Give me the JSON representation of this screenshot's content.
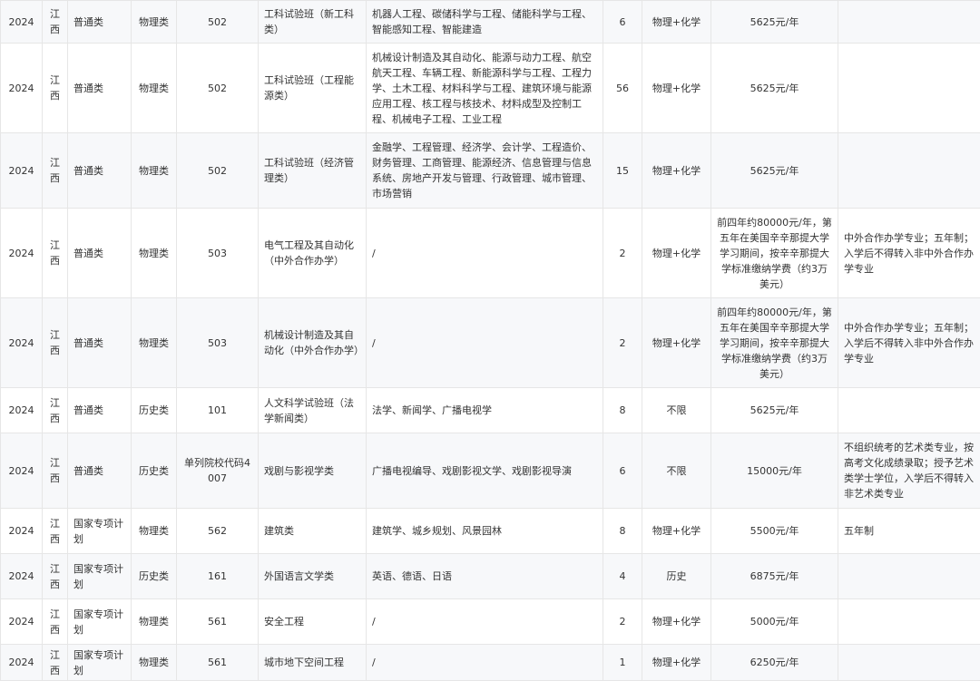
{
  "rows": [
    {
      "year": "2024",
      "province": "江西",
      "type": "普通类",
      "subject": "物理类",
      "code": "502",
      "group": "工科试验班（新工科类）",
      "majors": "机器人工程、碳储科学与工程、储能科学与工程、智能感知工程、智能建造",
      "count": "6",
      "requirement": "物理+化学",
      "tuition": "5625元/年",
      "note": ""
    },
    {
      "year": "2024",
      "province": "江西",
      "type": "普通类",
      "subject": "物理类",
      "code": "502",
      "group": "工科试验班（工程能源类）",
      "majors": "机械设计制造及其自动化、能源与动力工程、航空航天工程、车辆工程、新能源科学与工程、工程力学、土木工程、材料科学与工程、建筑环境与能源应用工程、核工程与核技术、材料成型及控制工程、机械电子工程、工业工程",
      "count": "56",
      "requirement": "物理+化学",
      "tuition": "5625元/年",
      "note": ""
    },
    {
      "year": "2024",
      "province": "江西",
      "type": "普通类",
      "subject": "物理类",
      "code": "502",
      "group": "工科试验班（经济管理类）",
      "majors": "金融学、工程管理、经济学、会计学、工程造价、财务管理、工商管理、能源经济、信息管理与信息系统、房地产开发与管理、行政管理、城市管理、市场营销",
      "count": "15",
      "requirement": "物理+化学",
      "tuition": "5625元/年",
      "note": ""
    },
    {
      "year": "2024",
      "province": "江西",
      "type": "普通类",
      "subject": "物理类",
      "code": "503",
      "group": "电气工程及其自动化（中外合作办学）",
      "majors": "/",
      "count": "2",
      "requirement": "物理+化学",
      "tuition": "前四年约80000元/年，第五年在美国辛辛那提大学学习期间，按辛辛那提大学标准缴纳学费（约3万美元）",
      "note": "中外合作办学专业；五年制；入学后不得转入非中外合作办学专业"
    },
    {
      "year": "2024",
      "province": "江西",
      "type": "普通类",
      "subject": "物理类",
      "code": "503",
      "group": "机械设计制造及其自动化（中外合作办学）",
      "majors": "/",
      "count": "2",
      "requirement": "物理+化学",
      "tuition": "前四年约80000元/年，第五年在美国辛辛那提大学学习期间，按辛辛那提大学标准缴纳学费（约3万美元）",
      "note": "中外合作办学专业；五年制；入学后不得转入非中外合作办学专业"
    },
    {
      "year": "2024",
      "province": "江西",
      "type": "普通类",
      "subject": "历史类",
      "code": "101",
      "group": "人文科学试验班（法学新闻类）",
      "majors": "法学、新闻学、广播电视学",
      "count": "8",
      "requirement": "不限",
      "tuition": "5625元/年",
      "note": ""
    },
    {
      "year": "2024",
      "province": "江西",
      "type": "普通类",
      "subject": "历史类",
      "code": "单列院校代码4007",
      "group": "戏剧与影视学类",
      "majors": "广播电视编导、戏剧影视文学、戏剧影视导演",
      "count": "6",
      "requirement": "不限",
      "tuition": "15000元/年",
      "note": "不组织统考的艺术类专业，按高考文化成绩录取；授予艺术类学士学位，入学后不得转入非艺术类专业"
    },
    {
      "year": "2024",
      "province": "江西",
      "type": "国家专项计划",
      "subject": "物理类",
      "code": "562",
      "group": "建筑类",
      "majors": "建筑学、城乡规划、风景园林",
      "count": "8",
      "requirement": "物理+化学",
      "tuition": "5500元/年",
      "note": "五年制"
    },
    {
      "year": "2024",
      "province": "江西",
      "type": "国家专项计划",
      "subject": "历史类",
      "code": "161",
      "group": "外国语言文学类",
      "majors": "英语、德语、日语",
      "count": "4",
      "requirement": "历史",
      "tuition": "6875元/年",
      "note": ""
    },
    {
      "year": "2024",
      "province": "江西",
      "type": "国家专项计划",
      "subject": "物理类",
      "code": "561",
      "group": "安全工程",
      "majors": "/",
      "count": "2",
      "requirement": "物理+化学",
      "tuition": "5000元/年",
      "note": ""
    },
    {
      "year": "2024",
      "province": "江西",
      "type": "国家专项计划",
      "subject": "物理类",
      "code": "561",
      "group": "城市地下空间工程",
      "majors": "/",
      "count": "1",
      "requirement": "物理+化学",
      "tuition": "6250元/年",
      "note": ""
    }
  ]
}
